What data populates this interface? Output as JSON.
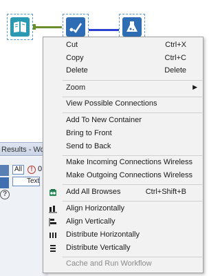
{
  "results_pane": {
    "title": "Results - Workflow",
    "all_label": "All",
    "error_count": "0",
    "text_label": "Text",
    "help_symbol": "?"
  },
  "context_menu": {
    "cut": {
      "label": "Cut",
      "shortcut": "Ctrl+X"
    },
    "copy": {
      "label": "Copy",
      "shortcut": "Ctrl+C"
    },
    "delete": {
      "label": "Delete",
      "shortcut": "Delete"
    },
    "zoom": {
      "label": "Zoom"
    },
    "view_connections": {
      "label": "View Possible Connections"
    },
    "add_container": {
      "label": "Add To New Container"
    },
    "bring_front": {
      "label": "Bring to Front"
    },
    "send_back": {
      "label": "Send to Back"
    },
    "incoming_wireless": {
      "label": "Make Incoming Connections Wireless"
    },
    "outgoing_wireless": {
      "label": "Make Outgoing Connections Wireless"
    },
    "add_browses": {
      "label": "Add All Browses",
      "shortcut": "Ctrl+Shift+B"
    },
    "align_h": {
      "label": "Align Horizontally"
    },
    "align_v": {
      "label": "Align Vertically"
    },
    "distribute_h": {
      "label": "Distribute Horizontally"
    },
    "distribute_v": {
      "label": "Distribute Vertically"
    },
    "cache_run": {
      "label": "Cache and Run Workflow"
    }
  },
  "icons": [
    "book-tool-icon",
    "checkmark-tool-icon",
    "lab-flask-tool-icon",
    "browse-icon",
    "align-horizontal-icon",
    "align-vertical-icon",
    "distribute-horizontal-icon",
    "distribute-vertical-icon",
    "error-icon",
    "help-icon",
    "chevron-right-icon"
  ],
  "colors": {
    "tool_teal": "#2a9ab3",
    "tool_blue": "#2e6db3",
    "connection_green": "#6a8f2a",
    "connection_blue": "#2a3fd1",
    "menu_bg": "#f2f2f2"
  }
}
